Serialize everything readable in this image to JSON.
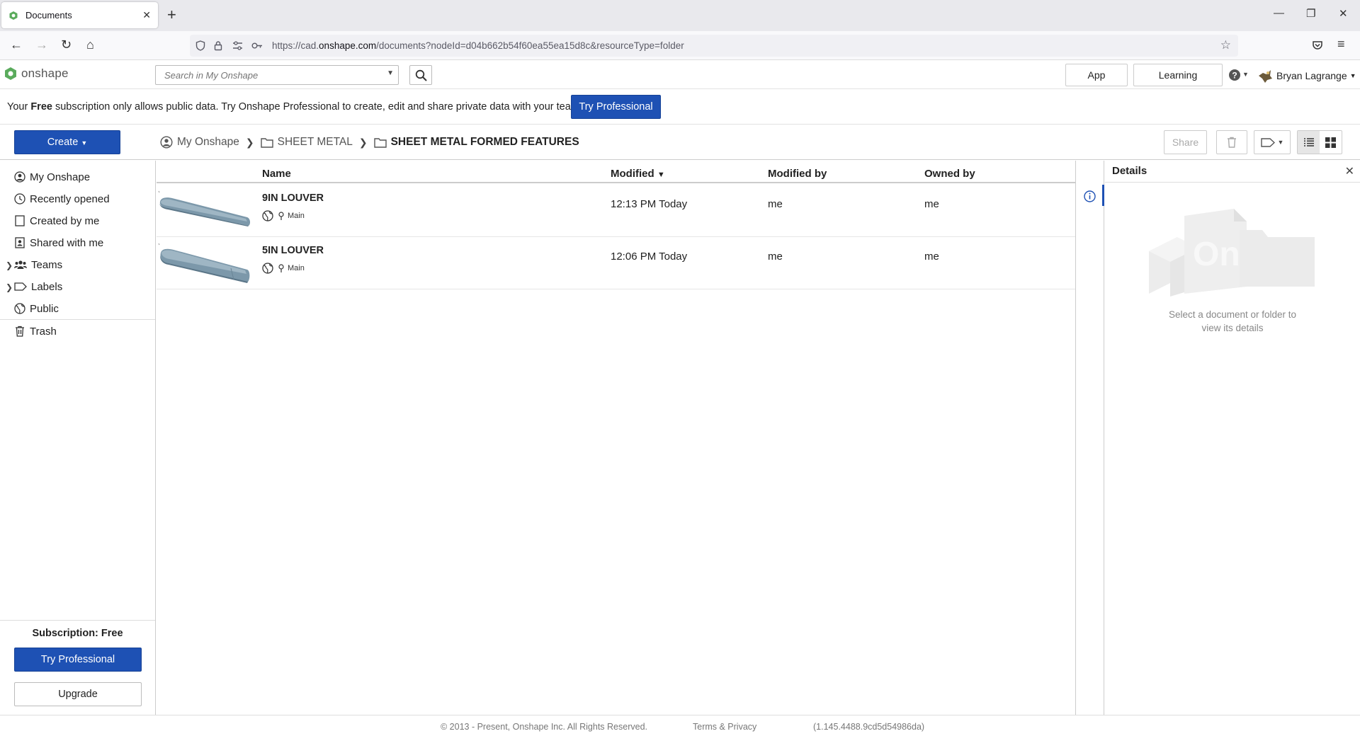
{
  "browser": {
    "tab_title": "Documents",
    "url_prefix": "https://cad.",
    "url_domain": "onshape.com",
    "url_path": "/documents?nodeId=d04b662b54f60ea55ea15d8c&resourceType=folder"
  },
  "header": {
    "logo_text": "onshape",
    "search_placeholder": "Search in My Onshape",
    "app_store_label": "App Store",
    "learning_center_label": "Learning Center",
    "user_name": "Bryan Lagrange"
  },
  "banner": {
    "prefix": "Your ",
    "emphasis": "Free",
    "suffix": " subscription only allows public data. Try Onshape Professional to create, edit and share private data with your team.",
    "cta_label": "Try Professional"
  },
  "toolbar": {
    "create_label": "Create",
    "breadcrumb": [
      "My Onshape",
      "SHEET METAL",
      "SHEET METAL FORMED FEATURES"
    ],
    "share_label": "Share"
  },
  "sidebar": {
    "items": [
      {
        "label": "My Onshape",
        "icon": "person-circle-icon"
      },
      {
        "label": "Recently opened",
        "icon": "clock-icon"
      },
      {
        "label": "Created by me",
        "icon": "document-icon"
      },
      {
        "label": "Shared with me",
        "icon": "shared-icon"
      },
      {
        "label": "Teams",
        "icon": "teams-icon"
      },
      {
        "label": "Labels",
        "icon": "label-icon"
      },
      {
        "label": "Public",
        "icon": "globe-icon"
      },
      {
        "label": "Trash",
        "icon": "trash-icon"
      }
    ],
    "subscription_label": "Subscription: Free",
    "try_label": "Try Professional",
    "upgrade_label": "Upgrade"
  },
  "table": {
    "columns": [
      "Name",
      "Modified",
      "Modified by",
      "Owned by"
    ],
    "sort_indicator": "▼",
    "rows": [
      {
        "name": "9IN LOUVER",
        "branch": "Main",
        "modified": "12:13 PM Today",
        "modified_by": "me",
        "owned_by": "me"
      },
      {
        "name": "5IN LOUVER",
        "branch": "Main",
        "modified": "12:06 PM Today",
        "modified_by": "me",
        "owned_by": "me"
      }
    ]
  },
  "details": {
    "title": "Details",
    "hint_line1": "Select a document or folder to",
    "hint_line2": "view its details"
  },
  "footer": {
    "copyright": "© 2013 - Present, Onshape Inc. All Rights Reserved.",
    "terms": "Terms & Privacy",
    "version": "(1.145.4488.9cd5d54986da)"
  },
  "colors": {
    "primary": "#1e51b4",
    "logo_green": "#5aab5c"
  }
}
